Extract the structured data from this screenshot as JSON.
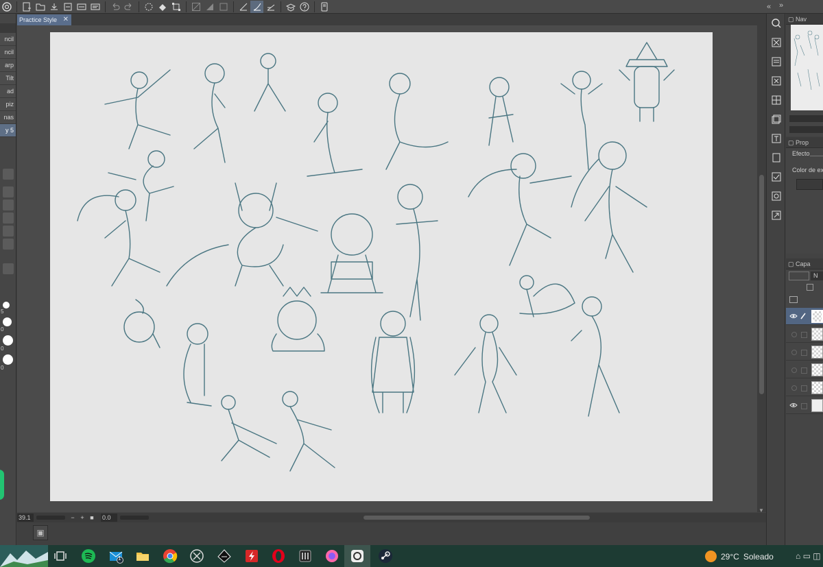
{
  "document": {
    "tab_title": "Practice Style",
    "tab_close": "✕"
  },
  "toolbar": {
    "buttons": [
      "app-icon",
      "new-icon",
      "open-icon",
      "save-icon",
      "export-icon",
      "export-png-icon",
      "export-psd-icon",
      "undo-icon",
      "redo-icon",
      "clear-icon",
      "fill-icon",
      "transform-icon",
      "crop-icon",
      "hide-selection-icon",
      "selection-outline-icon",
      "clear-outside-icon",
      "snap-ruler-icon",
      "snap-special-ruler-icon",
      "snap-grid-icon",
      "layer-icon",
      "help-icon",
      "device-icon"
    ],
    "right_arrows": "« ",
    "right_more": "»"
  },
  "left_panel": {
    "brush_labels": [
      "ncil",
      "ncil",
      "arp",
      "Tilt",
      "ad",
      "piz",
      "nas",
      "y 5"
    ],
    "size_labels": [
      "5",
      "0",
      "0",
      "0"
    ]
  },
  "status": {
    "zoom": "39.1",
    "minus": "−",
    "plus": "+",
    "stop": "■",
    "rotation": "0.0"
  },
  "right_panels": {
    "navigator_title": "Nav",
    "properties_title": "Prop",
    "effect_label": "Efecto",
    "expression_color_label": "Color de exp",
    "layers_title": "Capa",
    "blend_mode": "N"
  },
  "taskbar": {
    "apps": [
      "task-view-icon",
      "spotify-icon",
      "mail-icon",
      "file-explorer-icon",
      "chrome-icon",
      "xbox-icon",
      "inkscape-icon",
      "flash-icon",
      "opera-icon",
      "equalizer-icon",
      "osu-icon",
      "clip-studio-icon",
      "steam-icon"
    ],
    "mail_badge": "1",
    "weather_temp": "29°C",
    "weather_text": "Soleado"
  },
  "colors": {
    "sketch_stroke": "#4a7682",
    "paper": "#e6e6e6",
    "selection_blue": "#5a6e8c",
    "weather_sun": "#f19422"
  }
}
